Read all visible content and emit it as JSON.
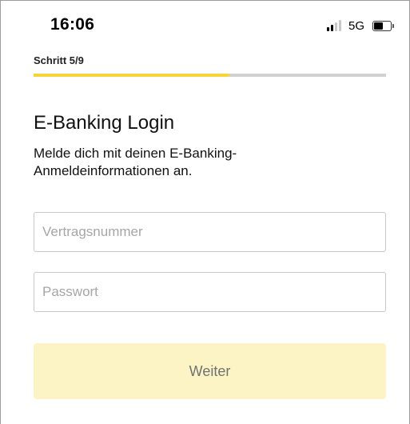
{
  "status_bar": {
    "time": "16:06",
    "network": "5G",
    "signal_bars_active": 2,
    "signal_bars_total": 4,
    "battery_level": 0.55
  },
  "progress": {
    "step_label": "Schritt 5/9",
    "current": 5,
    "total": 9,
    "fraction": 0.556
  },
  "login": {
    "title": "E-Banking Login",
    "subtitle": "Melde dich mit deinen E-Banking-Anmeldeinformationen an.",
    "contract_field": {
      "placeholder": "Vertragsnummer",
      "value": ""
    },
    "password_field": {
      "placeholder": "Passwort",
      "value": ""
    },
    "submit_label": "Weiter"
  },
  "colors": {
    "progress_fill": "#f5d53a",
    "progress_track": "#d1d1d1",
    "button_background": "#fdf4c6",
    "button_text": "#717171"
  }
}
